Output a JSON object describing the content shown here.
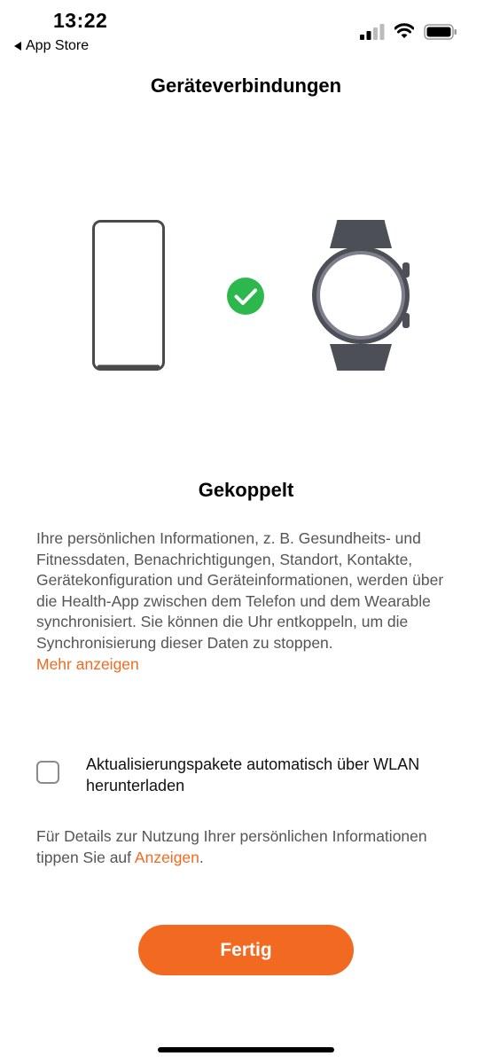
{
  "status_bar": {
    "time": "13:22",
    "back_label": "App Store"
  },
  "header": {
    "title": "Geräteverbindungen"
  },
  "illustration": {
    "icons": [
      "phone-icon",
      "check-circle-icon",
      "watch-icon"
    ],
    "check_color": "#2db84d"
  },
  "connection": {
    "status": "Gekoppelt",
    "description": "Ihre persönlichen Informationen, z. B. Gesundheits- und Fitnessdaten, Benachrichtigungen, Standort, Kontakte, Gerätekonfiguration und Geräteinformationen, werden über die Health-App zwischen dem Telefon und dem Wearable synchronisiert. Sie können die Uhr entkoppeln, um die Synchronisierung dieser Daten zu stoppen.",
    "more_link": "Mehr anzeigen"
  },
  "auto_update": {
    "label": "Aktualisierungspakete automatisch über WLAN herunterladen",
    "checked": false
  },
  "privacy": {
    "text": "Für Details zur Nutzung Ihrer persönlichen Informationen tippen Sie auf ",
    "link": "Anzeigen",
    "suffix": "."
  },
  "done_button": {
    "label": "Fertig"
  },
  "colors": {
    "accent": "#f26a21",
    "watch_body": "#4c4f56",
    "watch_bezel": "#7e7f8c"
  }
}
